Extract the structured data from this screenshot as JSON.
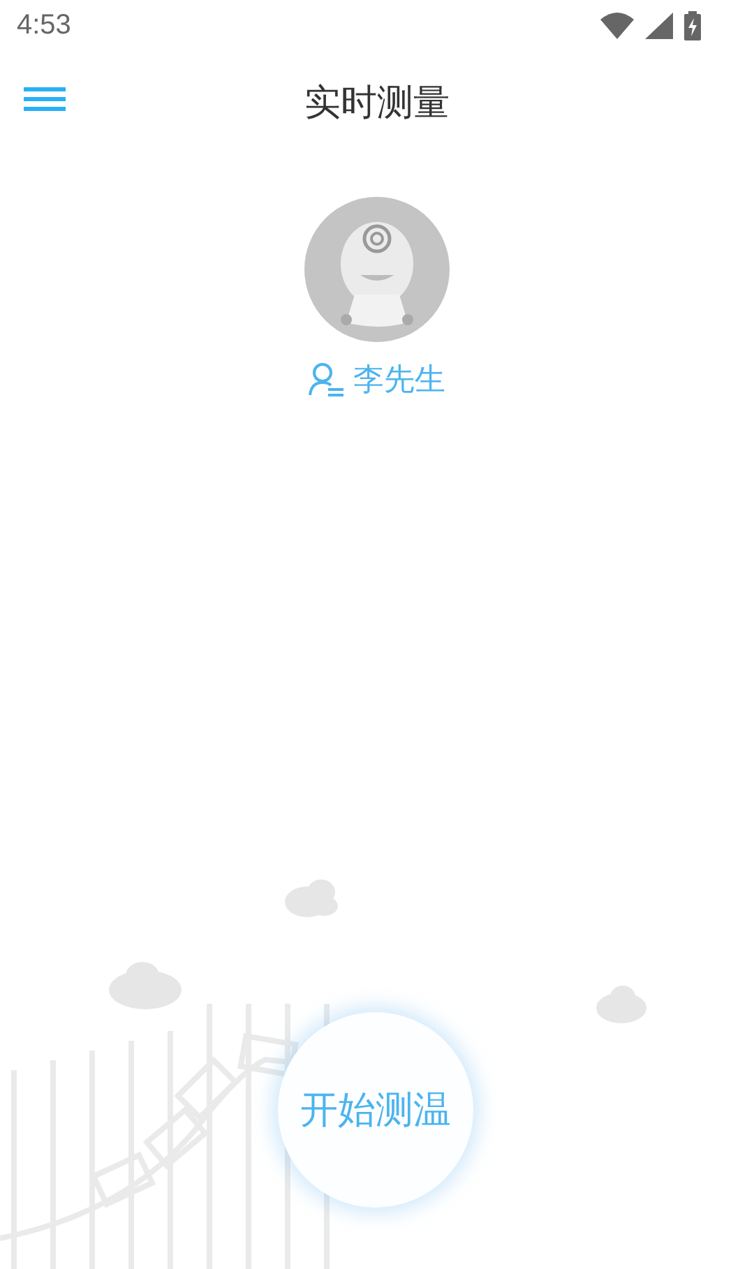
{
  "status_bar": {
    "time": "4:53"
  },
  "app_bar": {
    "title": "实时测量"
  },
  "profile": {
    "name": "李先生"
  },
  "start_button": {
    "label": "开始测温"
  }
}
